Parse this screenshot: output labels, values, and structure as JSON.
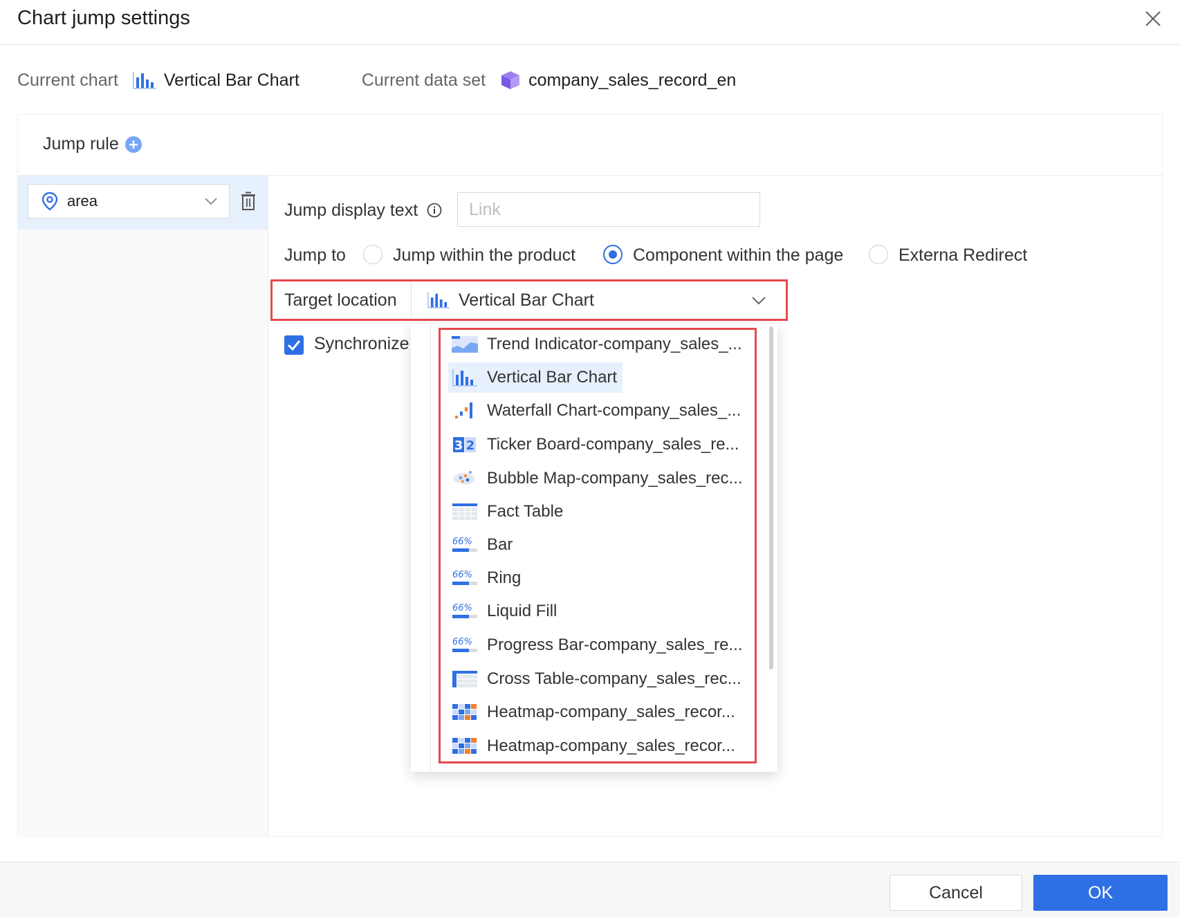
{
  "dialog": {
    "title": "Chart jump settings"
  },
  "info": {
    "current_chart_label": "Current chart",
    "current_chart_value": "Vertical Bar Chart",
    "current_dataset_label": "Current data set",
    "current_dataset_value": "company_sales_record_en"
  },
  "panel": {
    "jump_rule_label": "Jump rule",
    "rule_field": "area",
    "jump_display_text_label": "Jump display text",
    "link_placeholder": "Link",
    "jump_to_label": "Jump to",
    "jump_options": [
      {
        "label": "Jump within the product",
        "checked": false
      },
      {
        "label": "Component within the page",
        "checked": true
      },
      {
        "label": "Externa Redirect",
        "checked": false
      }
    ],
    "target_location_label": "Target location",
    "target_location_value": "Vertical Bar Chart",
    "synchronize_label": "Synchronize"
  },
  "dropdown": {
    "items": [
      {
        "label": "Trend Indicator-company_sales_...",
        "icon": "trend-indicator-icon"
      },
      {
        "label": "Vertical Bar Chart",
        "icon": "vertical-bar-chart-icon",
        "selected": true
      },
      {
        "label": "Waterfall Chart-company_sales_...",
        "icon": "waterfall-chart-icon"
      },
      {
        "label": "Ticker Board-company_sales_re...",
        "icon": "ticker-board-icon"
      },
      {
        "label": "Bubble Map-company_sales_rec...",
        "icon": "bubble-map-icon"
      },
      {
        "label": "Fact Table",
        "icon": "fact-table-icon"
      },
      {
        "label": "Bar",
        "icon": "progress-icon"
      },
      {
        "label": "Ring",
        "icon": "progress-icon"
      },
      {
        "label": "Liquid Fill",
        "icon": "progress-icon"
      },
      {
        "label": "Progress Bar-company_sales_re...",
        "icon": "progress-icon"
      },
      {
        "label": "Cross Table-company_sales_rec...",
        "icon": "cross-table-icon"
      },
      {
        "label": "Heatmap-company_sales_recor...",
        "icon": "heatmap-icon"
      },
      {
        "label": "Heatmap-company_sales_recor...",
        "icon": "heatmap-icon"
      }
    ],
    "progress_icon_text": "66%",
    "ticker_icon_digits": [
      "3",
      "2"
    ]
  },
  "footer": {
    "cancel_label": "Cancel",
    "ok_label": "OK"
  },
  "colors": {
    "accent": "#2f6fe4",
    "highlight_border": "#e5484d",
    "selected_bg": "#e7f0fd",
    "orange": "#f5802a"
  }
}
